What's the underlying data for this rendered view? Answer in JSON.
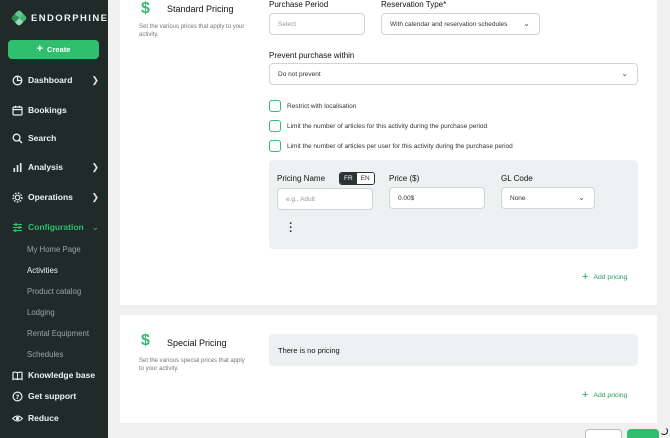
{
  "app": {
    "brand": "ENDORPHINE",
    "create_label": "Create",
    "brand_color": "#2fbf6f"
  },
  "sidebar": {
    "items": [
      {
        "label": "Dashboard"
      },
      {
        "label": "Bookings"
      },
      {
        "label": "Search"
      },
      {
        "label": "Analysis"
      },
      {
        "label": "Operations"
      },
      {
        "label": "Configuration"
      }
    ],
    "sub_items": [
      {
        "label": "My Home Page"
      },
      {
        "label": "Activities"
      },
      {
        "label": "Product catalog"
      },
      {
        "label": "Lodging"
      },
      {
        "label": "Rental Equipment"
      },
      {
        "label": "Schedules"
      }
    ],
    "bottom": [
      {
        "label": "Knowledge base"
      },
      {
        "label": "Get support"
      },
      {
        "label": "Reduce"
      }
    ]
  },
  "standard": {
    "title": "Standard Pricing",
    "desc": "Set the various prices that apply to your activity.",
    "purchase_period_label": "Purchase Period",
    "purchase_period_placeholder": "Select",
    "reservation_type_label": "Reservation Type*",
    "reservation_type_value": "With calendar and reservation schedules",
    "prevent_label": "Prevent purchase within",
    "prevent_value": "Do not prevent",
    "checks": [
      "Restrict with localisation",
      "Limit the number of articles for this activity during the purchase period",
      "Limit the number of articles per user for this activity during the purchase period"
    ],
    "pricing_name_label": "Pricing Name",
    "lang_on": "FR",
    "lang_off": "EN",
    "pricing_name_placeholder": "e.g., Adult",
    "price_label": "Price ($)",
    "price_value": "0.00$",
    "gl_label": "GL Code",
    "gl_value": "None",
    "add_pricing": "Add pricing"
  },
  "special": {
    "title": "Special Pricing",
    "desc": "Set the various special prices that apply to your activity.",
    "empty": "There is no pricing",
    "add_pricing": "Add pricing"
  }
}
